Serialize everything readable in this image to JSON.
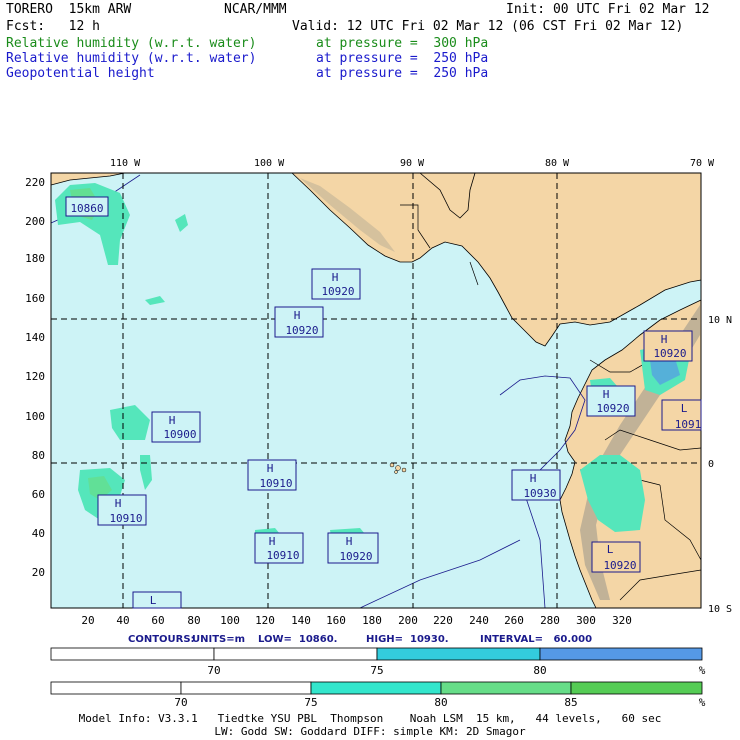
{
  "header": {
    "model": "TORERO  15km ARW",
    "center": "NCAR/MMM",
    "init": "Init: 00 UTC Fri 02 Mar 12",
    "fcst": "Fcst:   12 h",
    "valid": "Valid: 12 UTC Fri 02 Mar 12 (06 CST Fri 02 Mar 12)",
    "fields": [
      {
        "name": "Relative humidity (w.r.t. water)",
        "level": "at pressure =  300 hPa",
        "color": "#1a8c1a"
      },
      {
        "name": "Relative humidity (w.r.t. water)",
        "level": "at pressure =  250 hPa",
        "color": "#1a1acc"
      },
      {
        "name": "Geopotential height",
        "level": "at pressure =  250 hPa",
        "color": "#1a1acc"
      }
    ]
  },
  "map": {
    "lon_labels": [
      "110 W",
      "100 W",
      "90 W",
      "80 W",
      "70 W"
    ],
    "lat_labels": [
      "10 N",
      "0",
      "10 S"
    ],
    "y_ticks": [
      "220",
      "200",
      "180",
      "160",
      "140",
      "120",
      "100",
      "80",
      "60",
      "40",
      "20"
    ],
    "x_ticks": [
      "20",
      "40",
      "60",
      "80",
      "100",
      "120",
      "140",
      "160",
      "180",
      "200",
      "220",
      "240",
      "260",
      "280",
      "300",
      "320"
    ],
    "ocean_color": "#cdf3f6",
    "land_color": "#f4d6a6",
    "highs_lows": [
      {
        "type": "H",
        "value": "10860"
      },
      {
        "type": "H",
        "value": "10920"
      },
      {
        "type": "H",
        "value": "10920"
      },
      {
        "type": "H",
        "value": "10920"
      },
      {
        "type": "H",
        "value": "10920"
      },
      {
        "type": "L",
        "value": "1091"
      },
      {
        "type": "H",
        "value": "10900"
      },
      {
        "type": "H",
        "value": "10910"
      },
      {
        "type": "H",
        "value": "10930"
      },
      {
        "type": "H",
        "value": "10910"
      },
      {
        "type": "H",
        "value": "10910"
      },
      {
        "type": "H",
        "value": "10920"
      },
      {
        "type": "L",
        "value": "10920"
      },
      {
        "type": "L",
        "value": ""
      }
    ]
  },
  "contours": {
    "label": "CONTOURS:",
    "units": "UNITS=m",
    "low": "LOW=  10860.",
    "high": "HIGH=  10930.",
    "interval": "INTERVAL=   60.000"
  },
  "colorbar1": {
    "labels": [
      "70",
      "75",
      "80"
    ],
    "unit": "%",
    "colors": [
      "#ffffff",
      "#ffffff",
      "#33ccdd",
      "#5599e6"
    ]
  },
  "colorbar2": {
    "labels": [
      "70",
      "75",
      "80",
      "85"
    ],
    "unit": "%",
    "colors": [
      "#ffffff",
      "#ffffff",
      "#33e6cc",
      "#66dd88",
      "#55cc55"
    ]
  },
  "footer": {
    "line1": "Model Info: V3.3.1   Tiedtke YSU PBL  Thompson    Noah LSM  15 km,   44 levels,   60 sec",
    "line2": "LW: Godd SW: Goddard DIFF: simple KM: 2D Smagor"
  }
}
